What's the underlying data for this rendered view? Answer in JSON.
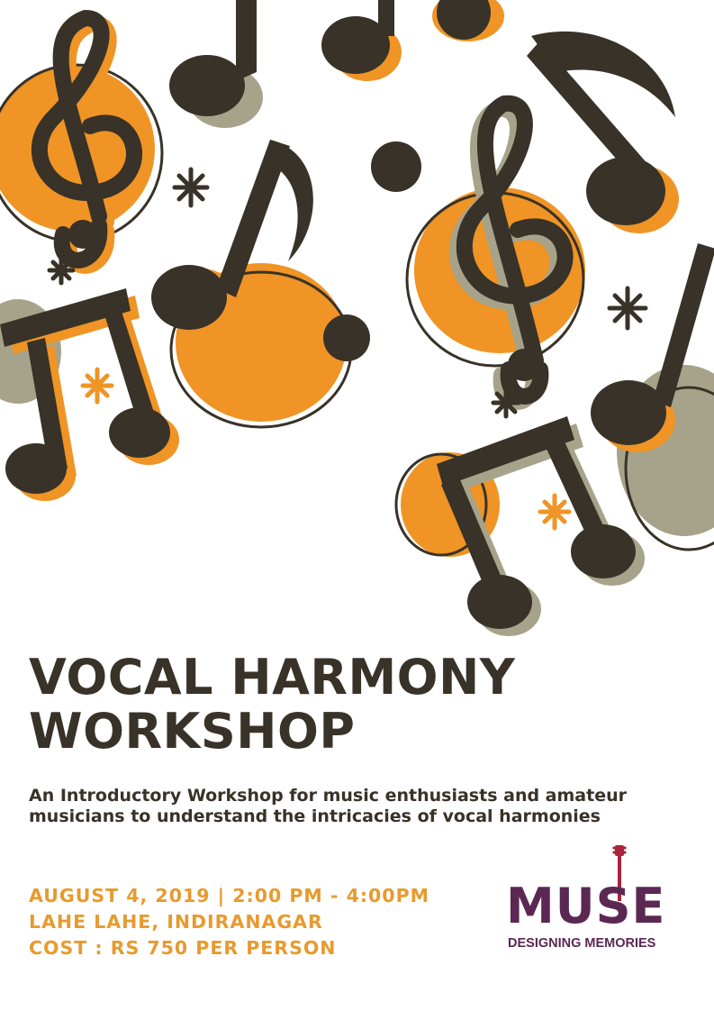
{
  "poster": {
    "title_line1": "VOCAL HARMONY",
    "title_line2": "WORKSHOP",
    "subtitle": "An Introductory Workshop for music enthusiasts and amateur musicians to understand the intricacies of vocal harmonies",
    "date_time": "AUGUST 4, 2019 | 2:00 PM - 4:00PM",
    "venue": "LAHE LAHE, INDIRANAGAR",
    "cost": "COST : RS 750 PER PERSON"
  },
  "logo": {
    "name": "MUSE",
    "tagline": "DESIGNING MEMORIES"
  },
  "colors": {
    "ink": "#383228",
    "orange": "#ef9425",
    "sage": "#a7a38b",
    "detail_text": "#e89a2e",
    "logo_purple": "#5a2852",
    "logo_red": "#a8243a"
  },
  "illustration": {
    "icons": [
      "treble-clef-icon",
      "eighth-note-icon",
      "beamed-notes-icon",
      "star-icon"
    ]
  }
}
